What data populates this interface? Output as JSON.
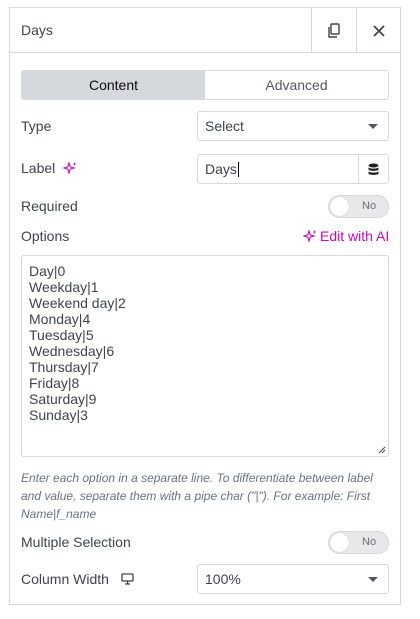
{
  "header": {
    "title": "Days",
    "copy_icon": "duplicate-icon",
    "close_icon": "close-icon"
  },
  "tabs": [
    {
      "label": "Content",
      "active": true
    },
    {
      "label": "Advanced",
      "active": false
    }
  ],
  "fields": {
    "type": {
      "label": "Type",
      "value": "Select"
    },
    "label": {
      "label": "Label",
      "value": "Days",
      "ai_icon": "sparkle-icon",
      "dynamic_icon": "database-icon"
    },
    "required": {
      "label": "Required",
      "toggle_text": "No",
      "on": false
    },
    "options": {
      "label": "Options",
      "edit_ai": "Edit with AI",
      "lines": [
        "Day|0",
        "Weekday|1",
        "Weekend day|2",
        "Monday|4",
        "Tuesday|5",
        "Wednesday|6",
        "Thursday|7",
        "Friday|8",
        "Saturday|9",
        "Sunday|3"
      ],
      "help": "Enter each option in a separate line. To differentiate between label and value, separate them with a pipe char (\"|\"). For example: First Name|f_name"
    },
    "multiple_selection": {
      "label": "Multiple Selection",
      "toggle_text": "No",
      "on": false
    },
    "column_width": {
      "label": "Column Width",
      "value": "100%",
      "device_icon": "desktop-icon"
    }
  },
  "colors": {
    "accent_ai": "#c00bb9",
    "border": "#d5d8dc",
    "tab_active_bg": "#d5d8dc",
    "text": "#3f444b"
  }
}
